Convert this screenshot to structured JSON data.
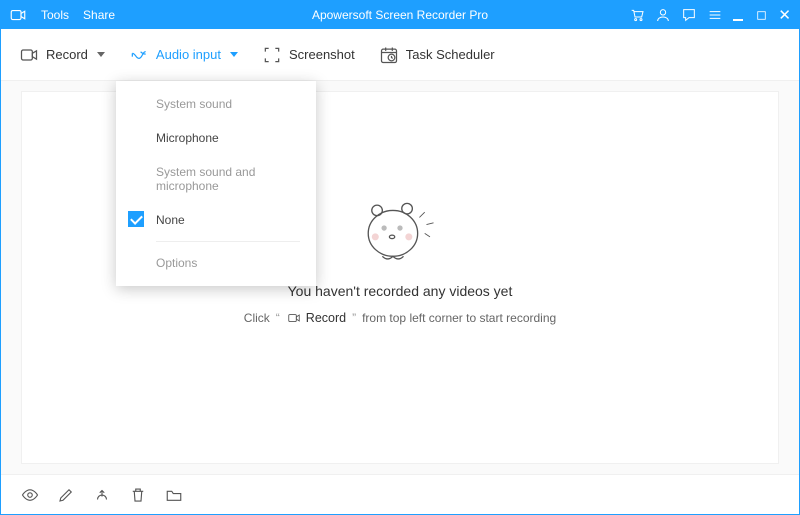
{
  "titlebar": {
    "menu_tools": "Tools",
    "menu_share": "Share",
    "title": "Apowersoft Screen Recorder Pro"
  },
  "toolbar": {
    "record": "Record",
    "audio_input": "Audio input",
    "screenshot": "Screenshot",
    "task_scheduler": "Task Scheduler"
  },
  "audio_dropdown": {
    "system_sound": "System sound",
    "microphone": "Microphone",
    "system_and_mic": "System sound and microphone",
    "none": "None",
    "options": "Options",
    "selected": "none"
  },
  "empty_state": {
    "title": "You haven't recorded any videos yet",
    "click": "Click",
    "record": "Record",
    "suffix": "from top left corner to start recording"
  }
}
